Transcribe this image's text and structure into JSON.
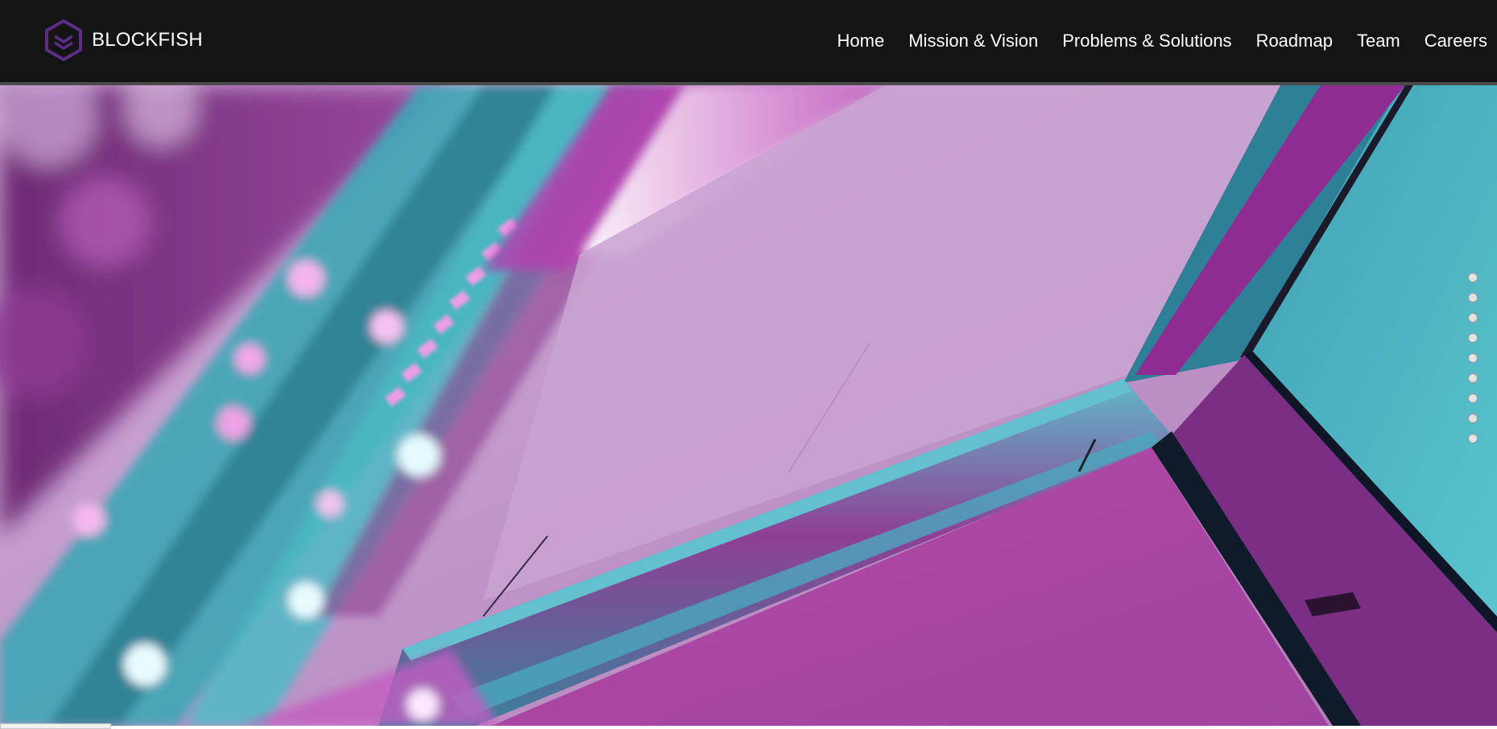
{
  "header": {
    "brand": "BLOCKFISH",
    "logo_icon": "hexagon-chevron-logo-icon",
    "brand_color": "#5c2c86"
  },
  "nav": {
    "items": [
      {
        "label": "Home"
      },
      {
        "label": "Mission & Vision"
      },
      {
        "label": "Problems & Solutions"
      },
      {
        "label": "Roadmap"
      },
      {
        "label": "Team"
      },
      {
        "label": "Careers"
      }
    ]
  },
  "hero": {
    "image": "abstract-neon-magenta-cyan-cube-illustration",
    "colors": {
      "magenta": "#b24aa6",
      "cyan": "#4fb8c6",
      "lilac": "#c39ccc"
    }
  },
  "pagination": {
    "dot_count": 9,
    "dot_color": "#e4e4e4"
  }
}
